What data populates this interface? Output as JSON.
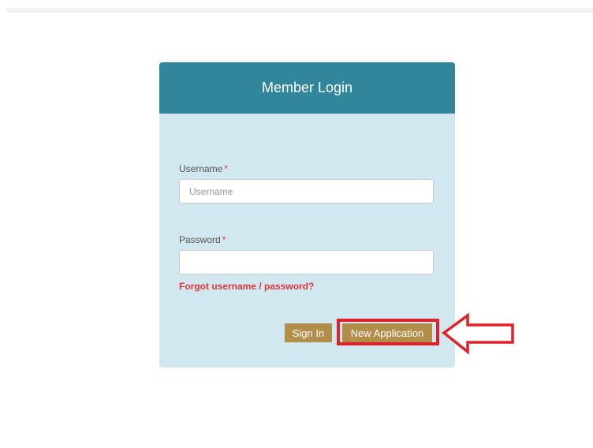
{
  "login": {
    "title": "Member Login",
    "username_label": "Username",
    "username_required": "*",
    "username_placeholder": "Username",
    "username_value": "",
    "password_label": "Password",
    "password_required": "*",
    "password_value": "",
    "forgot_link": "Forgot username / password?",
    "signin_label": "Sign In",
    "new_application_label": "New Application"
  },
  "colors": {
    "header": "#31869b",
    "panel": "#d1e8f0",
    "button": "#b38d4a",
    "required": "#e0343a",
    "annotation": "#e0202a"
  },
  "annotation": {
    "arrow_icon": "arrow-left-icon",
    "target": "New Application"
  }
}
